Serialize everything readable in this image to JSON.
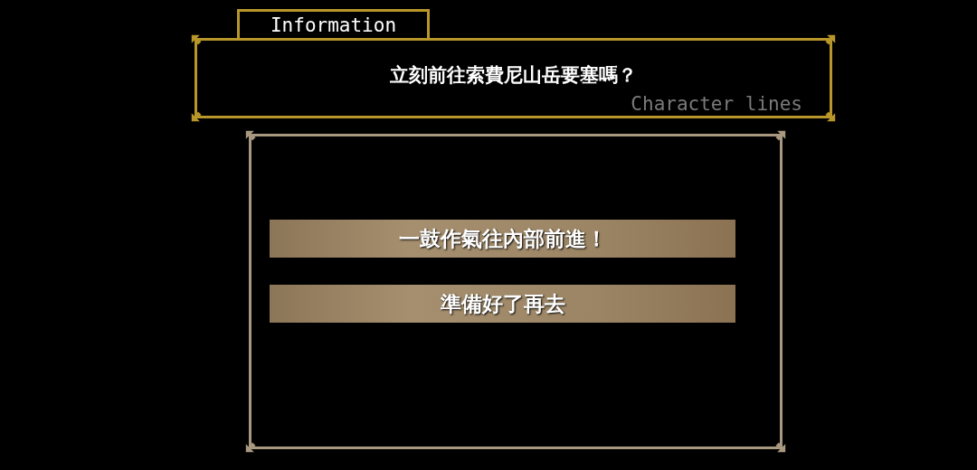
{
  "header_tab": {
    "label": "Information"
  },
  "message": {
    "text": "立刻前往索費尼山岳要塞嗎？",
    "caption": "Character lines"
  },
  "choices": [
    {
      "label": "一鼓作氣往內部前進！"
    },
    {
      "label": "準備好了再去"
    }
  ]
}
